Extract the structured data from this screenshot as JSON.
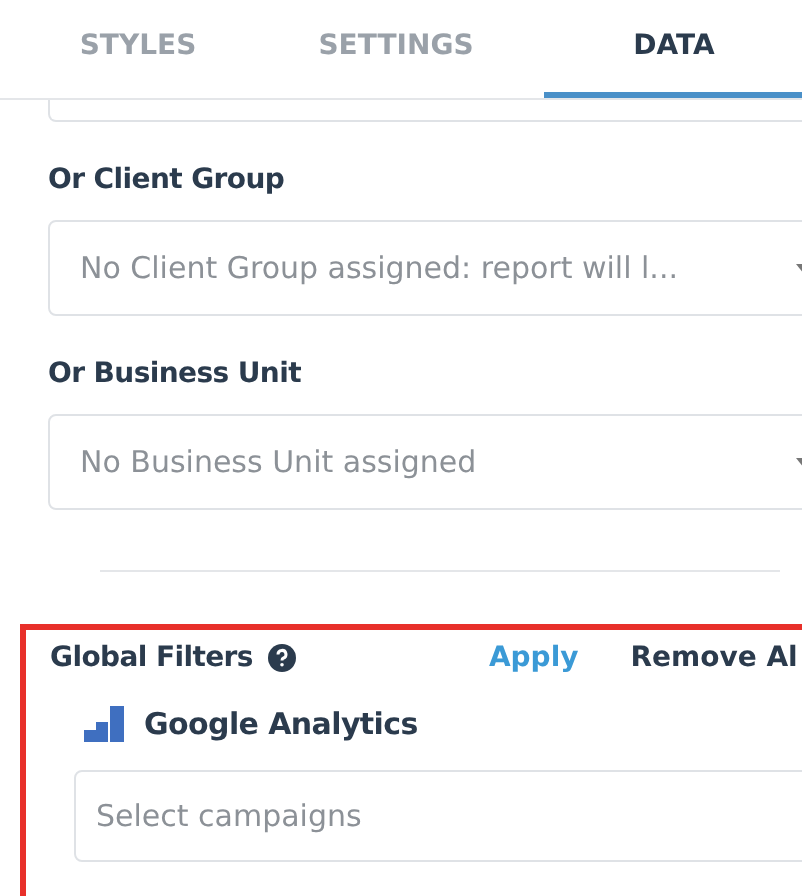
{
  "tabs": [
    {
      "label": "STYLES",
      "selected": false
    },
    {
      "label": "SETTINGS",
      "selected": false
    },
    {
      "label": "DATA",
      "selected": true
    }
  ],
  "fields": [
    {
      "label": "Or Client Group",
      "placeholder": "No Client Group assigned: report will l..."
    },
    {
      "label": "Or Business Unit",
      "placeholder": "No Business Unit assigned"
    }
  ],
  "global_filters": {
    "title": "Global Filters",
    "apply": "Apply",
    "remove": "Remove Al",
    "source": "Google Analytics",
    "campaigns": {
      "placeholder": "Select campaigns"
    }
  }
}
